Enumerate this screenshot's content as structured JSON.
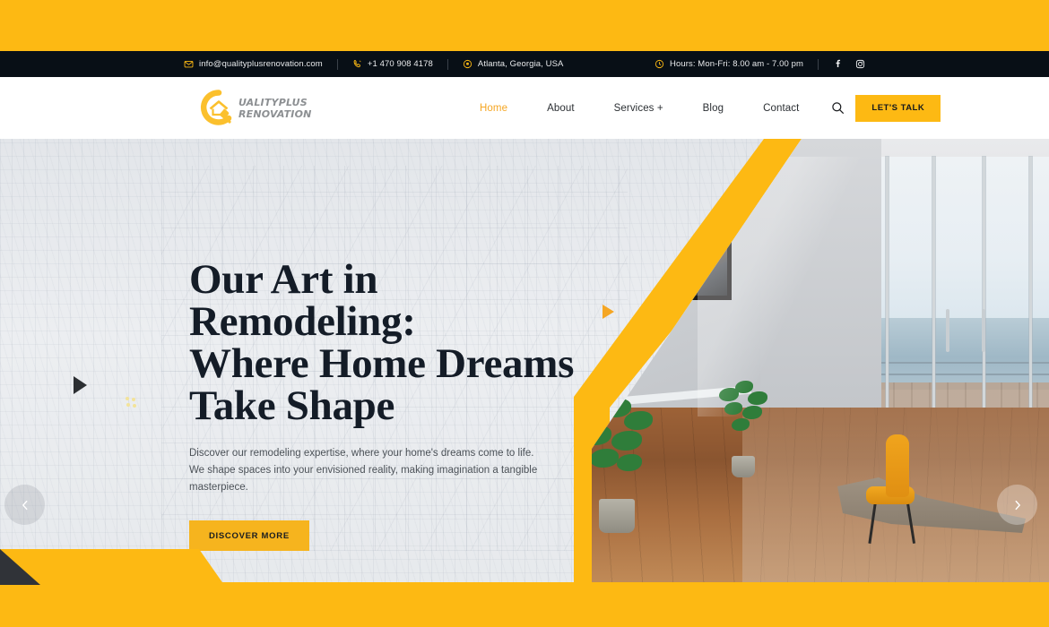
{
  "colors": {
    "brand_yellow": "#FDB913",
    "accent_yellow": "#F5A623",
    "dark_bar": "#080f16",
    "heading": "#141c27",
    "body_text": "#4c5258"
  },
  "topbar": {
    "email": "info@qualityplusrenovation.com",
    "phone": "+1 470 908 4178",
    "location": "Atlanta, Georgia, USA",
    "hours": "Hours: Mon-Fri: 8.00 am - 7.00 pm",
    "icons": {
      "email": "envelope-icon",
      "phone": "phone-icon",
      "location": "location-pin-icon",
      "hours": "clock-icon",
      "facebook": "facebook-icon",
      "instagram": "instagram-icon"
    }
  },
  "logo": {
    "mark": "q-house-plug-logo-icon",
    "line1": "UALITYPLUS",
    "line2": "RENOVATION"
  },
  "nav": {
    "items": [
      {
        "label": "Home",
        "active": true
      },
      {
        "label": "About",
        "active": false
      },
      {
        "label": "Services +",
        "active": false
      },
      {
        "label": "Blog",
        "active": false
      },
      {
        "label": "Contact",
        "active": false
      }
    ],
    "search_icon": "search-icon",
    "cta_label": "LET'S TALK"
  },
  "hero": {
    "title_line1": "Our Art in Remodeling:",
    "title_line2": "Where Home Dreams",
    "title_line3": "Take Shape",
    "subtitle": "Discover our remodeling expertise, where your home's dreams come to life. We shape spaces into your envisioned reality, making imagination a tangible masterpiece.",
    "cta_label": "DISCOVER MORE",
    "prev_icon": "chevron-left-icon",
    "next_icon": "chevron-right-icon",
    "decor": {
      "dark_triangle": "play-triangle-icon",
      "yellow_triangle": "play-triangle-icon",
      "dots": "dot-cluster-decoration"
    },
    "image_alt": "modern-interior-room-with-ocean-view"
  }
}
